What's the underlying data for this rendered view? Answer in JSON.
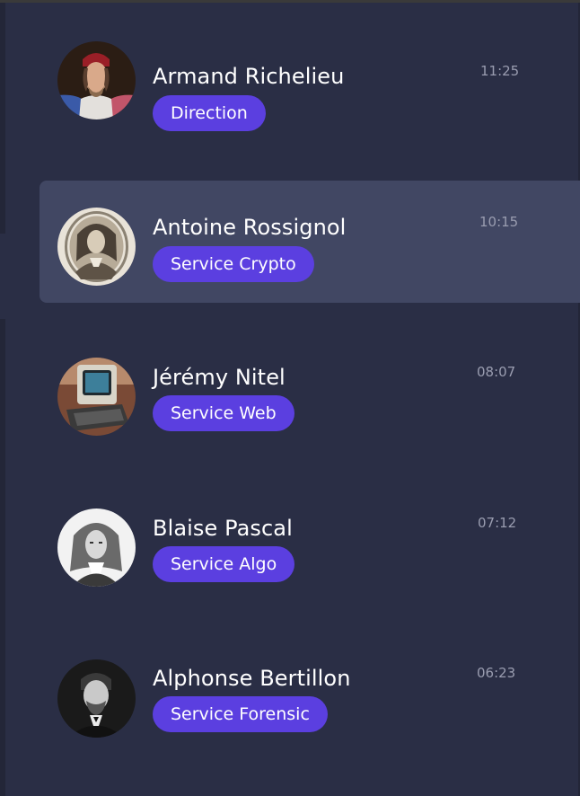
{
  "contacts": [
    {
      "name": "Armand Richelieu",
      "department": "Direction",
      "time": "11:25",
      "selected": false,
      "avatar_icon": "cardinal-portrait-avatar"
    },
    {
      "name": "Antoine Rossignol",
      "department": "Service Crypto",
      "time": "10:15",
      "selected": true,
      "avatar_icon": "engraved-portrait-avatar"
    },
    {
      "name": "Jérémy Nitel",
      "department": "Service Web",
      "time": "08:07",
      "selected": false,
      "avatar_icon": "minitel-terminal-avatar"
    },
    {
      "name": "Blaise Pascal",
      "department": "Service Algo",
      "time": "07:12",
      "selected": false,
      "avatar_icon": "pascal-engraving-avatar"
    },
    {
      "name": "Alphonse Bertillon",
      "department": "Service Forensic",
      "time": "06:23",
      "selected": false,
      "avatar_icon": "bertillon-photo-avatar"
    }
  ],
  "colors": {
    "background": "#2a2e45",
    "selected_row": "#414763",
    "badge": "#5b3fe0",
    "name_text": "#ffffff",
    "time_text": "#9a9db0"
  }
}
